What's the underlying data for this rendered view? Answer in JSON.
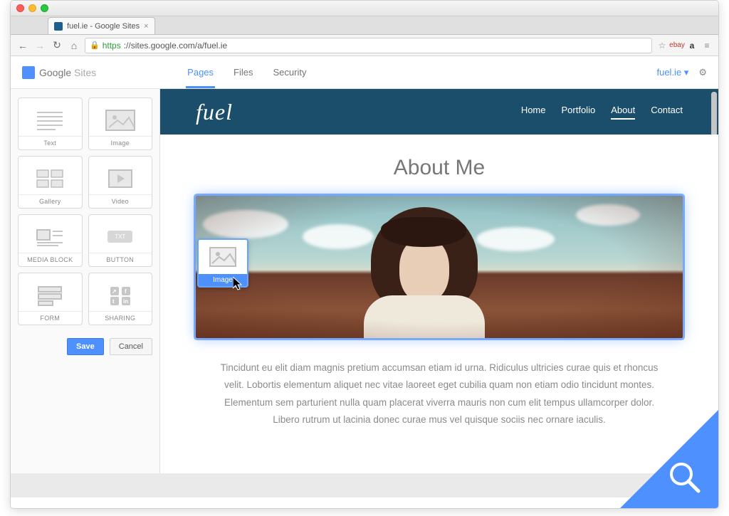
{
  "browser": {
    "tab_title": "fuel.ie - Google Sites",
    "url_scheme": "https",
    "url_host_path": "://sites.google.com/a/fuel.ie"
  },
  "app": {
    "product": "Google",
    "product_sub": "Sites",
    "tabs": {
      "pages": "Pages",
      "files": "Files",
      "security": "Security"
    },
    "account": "fuel.ie"
  },
  "widgets": {
    "text": "Text",
    "image": "Image",
    "gallery": "Gallery",
    "video": "Video",
    "media_block": "MEDIA BLOCK",
    "button": "BUTTON",
    "button_inner": "TXT",
    "form": "FORM",
    "sharing": "SHARING"
  },
  "actions": {
    "save": "Save",
    "cancel": "Cancel"
  },
  "site": {
    "brand": "fuel",
    "nav": {
      "home": "Home",
      "portfolio": "Portfolio",
      "about": "About",
      "contact": "Contact"
    }
  },
  "page": {
    "title": "About Me",
    "paragraph": "Tincidunt eu elit diam magnis pretium accumsan etiam id urna. Ridiculus ultricies curae quis et rhoncus velit. Lobortis elementum aliquet nec vitae laoreet eget cubilia quam non etiam odio tincidunt montes. Elementum sem parturient nulla quam placerat viverra mauris non cum elit tempus ullamcorper dolor. Libero rutrum ut lacinia donec curae mus vel quisque sociis nec ornare iaculis."
  },
  "drag": {
    "label": "Image"
  }
}
